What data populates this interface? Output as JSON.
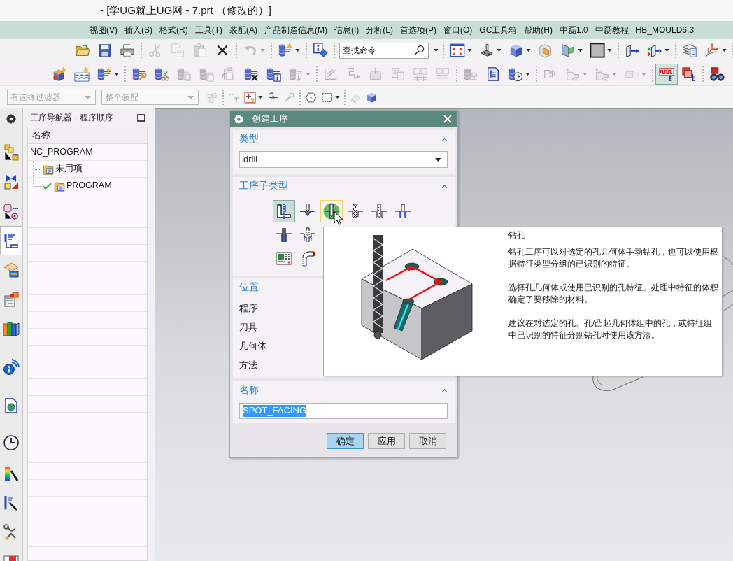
{
  "window": {
    "title": "- [学UG就上UG网 - 7.prt （修改的）]"
  },
  "menu": [
    "视图(V)",
    "插入(S)",
    "格式(R)",
    "工具(T)",
    "装配(A)",
    "产品制造信息(M)",
    "信息(I)",
    "分析(L)",
    "首选项(P)",
    "窗口(O)",
    "GC工具箱",
    "帮助(H)",
    "中磊1.0",
    "中磊教程",
    "HB_MOULD6.3"
  ],
  "toolbars": [
    {
      "items": [
        {
          "kind": "button",
          "disabled": false,
          "dropdown": false,
          "active": false
        },
        {
          "kind": "button",
          "disabled": false,
          "dropdown": false,
          "active": false
        },
        {
          "kind": "button",
          "disabled": false,
          "dropdown": false,
          "active": false
        },
        {
          "kind": "separator"
        },
        {
          "kind": "button",
          "disabled": true,
          "dropdown": false,
          "active": false
        },
        {
          "kind": "button",
          "disabled": true,
          "dropdown": false,
          "active": false
        },
        {
          "kind": "button",
          "disabled": true,
          "dropdown": false,
          "active": false
        },
        {
          "kind": "button",
          "disabled": false,
          "dropdown": false,
          "active": false
        },
        {
          "kind": "separator"
        },
        {
          "kind": "button",
          "disabled": true,
          "dropdown": true,
          "active": false
        },
        {
          "kind": "separator"
        },
        {
          "kind": "button",
          "disabled": false,
          "dropdown": true,
          "active": false
        },
        {
          "kind": "separator"
        },
        {
          "kind": "button",
          "disabled": false,
          "dropdown": false,
          "active": false
        },
        {
          "kind": "separator"
        },
        {
          "kind": "search",
          "placeholder": "查找命令",
          "dropdown": true
        },
        {
          "kind": "separator"
        },
        {
          "kind": "button",
          "disabled": false,
          "dropdown": true,
          "active": false
        },
        {
          "kind": "button",
          "disabled": false,
          "dropdown": true,
          "active": false
        },
        {
          "kind": "button",
          "disabled": false,
          "dropdown": true,
          "active": false
        },
        {
          "kind": "button",
          "disabled": false,
          "dropdown": false,
          "active": false
        },
        {
          "kind": "button",
          "disabled": false,
          "dropdown": true,
          "active": false
        },
        {
          "kind": "button",
          "disabled": false,
          "dropdown": true,
          "active": false
        },
        {
          "kind": "separator"
        },
        {
          "kind": "button",
          "disabled": false,
          "dropdown": false,
          "active": false
        },
        {
          "kind": "button",
          "disabled": false,
          "dropdown": true,
          "active": false
        },
        {
          "kind": "separator"
        },
        {
          "kind": "button",
          "disabled": false,
          "dropdown": false,
          "active": false
        },
        {
          "kind": "button",
          "disabled": false,
          "dropdown": true,
          "active": false
        },
        {
          "kind": "separator"
        }
      ]
    },
    {
      "items": [
        {
          "kind": "button",
          "disabled": false,
          "dropdown": false,
          "active": false
        },
        {
          "kind": "button",
          "disabled": false,
          "dropdown": false,
          "active": false
        },
        {
          "kind": "button",
          "disabled": false,
          "dropdown": true,
          "active": false
        },
        {
          "kind": "separator"
        },
        {
          "kind": "button",
          "disabled": false,
          "dropdown": false,
          "active": false
        },
        {
          "kind": "button",
          "disabled": false,
          "dropdown": false,
          "active": false
        },
        {
          "kind": "button",
          "disabled": true,
          "dropdown": false,
          "active": false
        },
        {
          "kind": "button",
          "disabled": true,
          "dropdown": false,
          "active": false
        },
        {
          "kind": "button",
          "disabled": true,
          "dropdown": false,
          "active": false
        },
        {
          "kind": "button",
          "disabled": false,
          "dropdown": false,
          "active": false
        },
        {
          "kind": "button",
          "disabled": false,
          "dropdown": false,
          "active": false
        },
        {
          "kind": "button",
          "disabled": true,
          "dropdown": true,
          "active": false
        },
        {
          "kind": "separator"
        },
        {
          "kind": "button",
          "disabled": true,
          "dropdown": false,
          "active": false
        },
        {
          "kind": "button",
          "disabled": true,
          "dropdown": false,
          "active": false
        },
        {
          "kind": "button",
          "disabled": true,
          "dropdown": false,
          "active": false
        },
        {
          "kind": "button",
          "disabled": true,
          "dropdown": false,
          "active": false
        },
        {
          "kind": "button",
          "disabled": true,
          "dropdown": false,
          "active": false
        },
        {
          "kind": "button",
          "disabled": true,
          "dropdown": false,
          "active": false
        },
        {
          "kind": "separator"
        },
        {
          "kind": "button",
          "disabled": true,
          "dropdown": false,
          "active": false
        },
        {
          "kind": "button",
          "disabled": false,
          "dropdown": false,
          "active": false
        },
        {
          "kind": "button",
          "disabled": false,
          "dropdown": true,
          "active": false
        },
        {
          "kind": "separator"
        },
        {
          "kind": "button",
          "disabled": true,
          "dropdown": false,
          "active": false
        },
        {
          "kind": "button",
          "disabled": true,
          "dropdown": true,
          "active": false
        },
        {
          "kind": "button",
          "disabled": true,
          "dropdown": true,
          "active": false
        },
        {
          "kind": "button",
          "disabled": true,
          "dropdown": true,
          "active": false
        },
        {
          "kind": "separator"
        },
        {
          "kind": "button",
          "disabled": false,
          "dropdown": false,
          "active": true
        },
        {
          "kind": "button",
          "disabled": false,
          "dropdown": false,
          "active": false
        },
        {
          "kind": "separator"
        },
        {
          "kind": "button",
          "disabled": false,
          "dropdown": false,
          "active": false
        }
      ]
    },
    {
      "items": [
        {
          "kind": "combo",
          "value": "有选择过滤器",
          "disabled": true
        },
        {
          "kind": "combo",
          "value": "整个装配",
          "disabled": true
        },
        {
          "kind": "button",
          "disabled": true,
          "dropdown": false,
          "active": false
        },
        {
          "kind": "separator"
        },
        {
          "kind": "button",
          "disabled": true,
          "dropdown": false,
          "active": false
        },
        {
          "kind": "button",
          "disabled": false,
          "dropdown": true,
          "active": false
        },
        {
          "kind": "button",
          "disabled": false,
          "dropdown": false,
          "active": false
        },
        {
          "kind": "button",
          "disabled": true,
          "dropdown": false,
          "active": false
        },
        {
          "kind": "separator"
        },
        {
          "kind": "button",
          "disabled": false,
          "dropdown": false,
          "active": false
        },
        {
          "kind": "button",
          "disabled": false,
          "dropdown": true,
          "active": false
        },
        {
          "kind": "separator"
        },
        {
          "kind": "button",
          "disabled": true,
          "dropdown": false,
          "active": false
        },
        {
          "kind": "button",
          "disabled": false,
          "dropdown": false,
          "active": false
        }
      ]
    }
  ],
  "resource_bar": [
    {
      "selected": false
    },
    {
      "selected": false
    },
    {
      "selected": false
    },
    {
      "selected": true
    },
    {
      "selected": false
    },
    {
      "selected": false
    },
    {
      "selected": false
    },
    {
      "selected": false
    },
    {
      "selected": false
    },
    {
      "selected": false
    },
    {
      "selected": false
    },
    {
      "selected": false
    },
    {
      "selected": false
    },
    {
      "selected": false
    }
  ],
  "navigator": {
    "title": "工序导航器 - 程序顺序",
    "columns": [
      "名称"
    ],
    "tree": [
      {
        "label": "NC_PROGRAM",
        "complete": false,
        "children": [
          {
            "label": "未用项",
            "kind": "group",
            "complete": false
          },
          {
            "label": "PROGRAM",
            "kind": "group",
            "complete": true
          }
        ]
      }
    ]
  },
  "dialog": {
    "title": "创建工序",
    "sections": [
      {
        "kind": "type",
        "title": "类型",
        "expanded": true,
        "value": "drill"
      },
      {
        "kind": "subtypes",
        "title": "工序子类型",
        "expanded": true,
        "rows": [
          [
            {
              "selected": true,
              "hovered": false
            },
            {
              "selected": false,
              "hovered": false
            },
            {
              "selected": false,
              "hovered": true
            },
            {
              "selected": false,
              "hovered": false
            },
            {
              "selected": false,
              "hovered": false
            },
            {
              "selected": false,
              "hovered": false
            }
          ],
          [
            {
              "selected": false,
              "hovered": false
            },
            {
              "selected": false,
              "hovered": false
            }
          ],
          [
            {
              "selected": false,
              "hovered": false
            },
            {
              "selected": false,
              "hovered": false
            }
          ]
        ]
      },
      {
        "kind": "fields",
        "title": "位置",
        "fields": [
          "程序",
          "刀具",
          "几何体",
          "方法"
        ]
      },
      {
        "kind": "name",
        "title": "名称",
        "expanded": true,
        "value": "SPOT_FACING",
        "text_selected": true
      }
    ],
    "buttons": [
      {
        "label": "确定",
        "default": true
      },
      {
        "label": "应用",
        "default": false
      },
      {
        "label": "取消",
        "default": false
      }
    ]
  },
  "tooltip": {
    "title": "钻孔",
    "paragraphs": [
      "钻孔工序可以对选定的孔几何体手动钻孔，也可以使用根据特征类型分组的已识别的特征。",
      "选择孔几何体或使用已识别的孔特征。处理中特征的体积确定了要移除的材料。",
      "建议在对选定的孔、孔/凸起几何体组中的孔，或特征组中已识别的特征分别钻孔时使用该方法。"
    ]
  }
}
